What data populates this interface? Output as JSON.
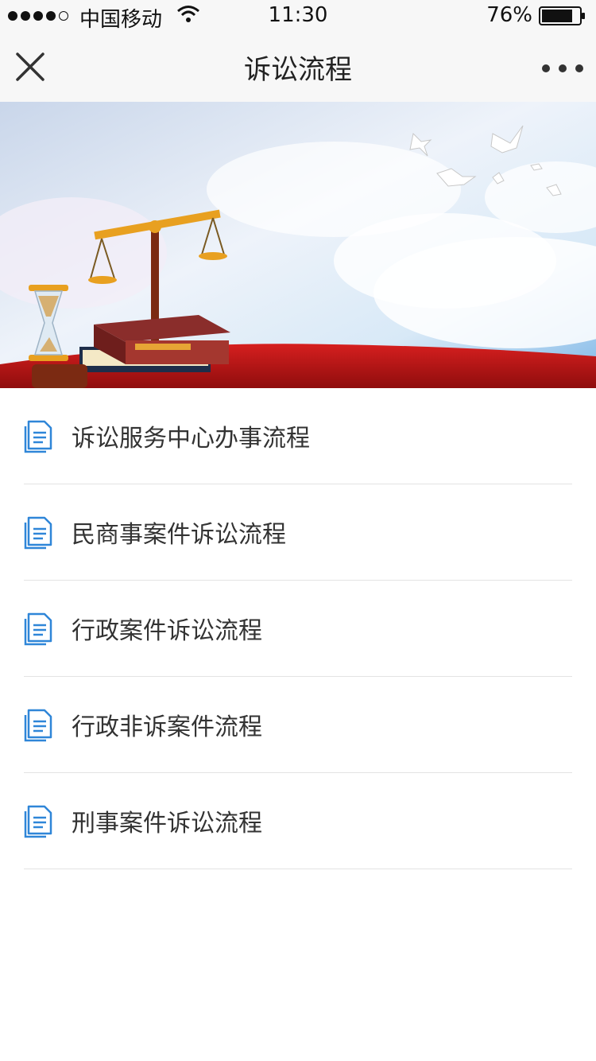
{
  "status_bar": {
    "carrier": "中国移动",
    "time": "11:30",
    "battery": "76%",
    "signal_bars_filled": 4,
    "signal_bars_total": 5,
    "battery_level": 0.76
  },
  "nav": {
    "title": "诉讼流程",
    "close_icon": "close-icon",
    "more_icon": "more-dots-icon"
  },
  "banner": {
    "illustration": "justice-scale-books-hourglass-doves"
  },
  "menu": {
    "items": [
      {
        "label": "诉讼服务中心办事流程",
        "icon": "document-icon"
      },
      {
        "label": "民商事案件诉讼流程",
        "icon": "document-icon"
      },
      {
        "label": "行政案件诉讼流程",
        "icon": "document-icon"
      },
      {
        "label": "行政非诉案件流程",
        "icon": "document-icon"
      },
      {
        "label": "刑事案件诉讼流程",
        "icon": "document-icon"
      }
    ],
    "icon_color": "#2f86d8"
  }
}
